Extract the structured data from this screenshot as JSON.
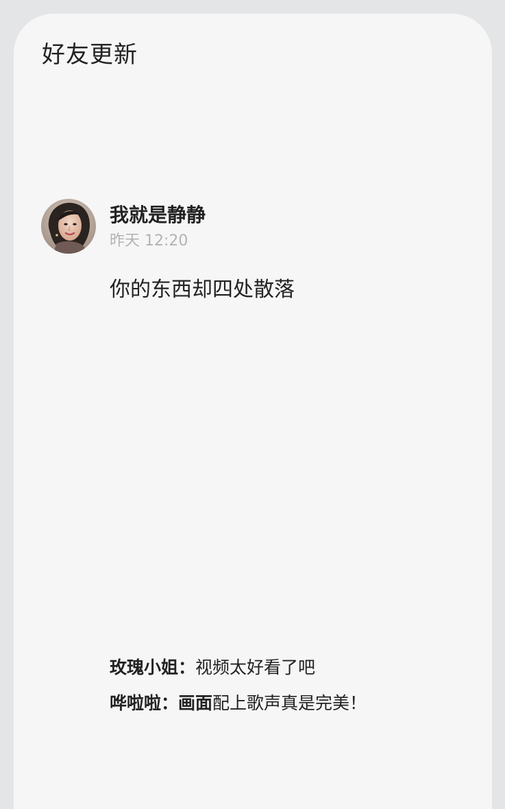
{
  "header": {
    "title": "好友更新"
  },
  "post": {
    "avatar_icon": "user-avatar-photo",
    "username": "我就是静静",
    "timestamp": "昨天 12:20",
    "text": "你的东西却四处散落"
  },
  "comments": [
    {
      "author": "玫瑰小姐：",
      "text": "视频太好看了吧"
    },
    {
      "author": "哗啦啦：",
      "highlight": "画面",
      "text": "配上歌声真是完美！"
    }
  ],
  "colors": {
    "page_background": "#e4e5e7",
    "card_background": "#f6f6f6",
    "text_primary": "#222222",
    "text_secondary": "#b3b3b3"
  }
}
